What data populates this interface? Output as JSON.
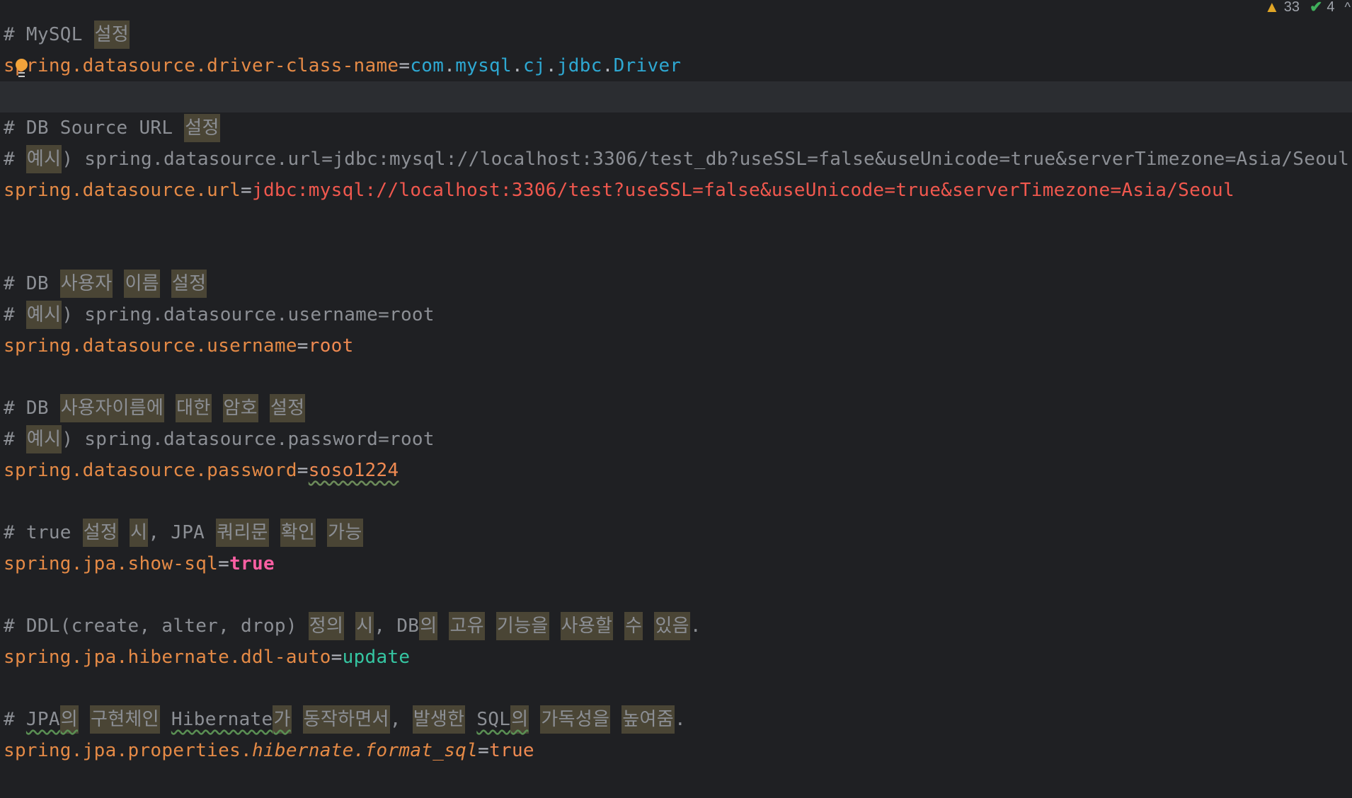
{
  "status": {
    "warnings": "33",
    "checks": "4",
    "warning_icon": "warning-triangle-icon",
    "check_icon": "double-check-icon",
    "chevron": "^"
  },
  "lines": {
    "l1": {
      "hash": "# ",
      "t1": "MySQL ",
      "k1": "설정"
    },
    "l2": {
      "key": "spring.datasource.driver-class-name",
      "eq": "=",
      "v1": "com",
      "d1": ".",
      "v2": "mysql",
      "d2": ".",
      "v3": "cj",
      "d3": ".",
      "v4": "jdbc",
      "d4": ".",
      "v5": "Driver"
    },
    "l4": {
      "hash": "# ",
      "t1": "DB Source URL ",
      "k1": "설정"
    },
    "l5": {
      "hash": "# ",
      "k1": "예시",
      "t1": ") spring.datasource.url=jdbc:mysql://localhost:3306/test_db?useSSL=false&useUnicode=true&serverTimezone=Asia/Seoul"
    },
    "l6": {
      "key": "spring.datasource.url",
      "eq": "=",
      "val": "jdbc:mysql://localhost:3306/test?useSSL=false&useUnicode=true&serverTimezone=Asia/Seoul"
    },
    "l9": {
      "hash": "# ",
      "t1": "DB ",
      "k1": "사용자",
      "k2": "이름",
      "k3": "설정"
    },
    "l10": {
      "hash": "# ",
      "k1": "예시",
      "t1": ") spring.datasource.username=root"
    },
    "l11": {
      "key": "spring.datasource.username",
      "eq": "=",
      "val": "root"
    },
    "l13": {
      "hash": "# ",
      "t1": "DB ",
      "k1": "사용자이름에",
      "k2": "대한",
      "k3": "암호",
      "k4": "설정"
    },
    "l14": {
      "hash": "# ",
      "k1": "예시",
      "t1": ") spring.datasource.password=root"
    },
    "l15": {
      "key": "spring.datasource.password",
      "eq": "=",
      "val": "soso1224"
    },
    "l17": {
      "hash": "# ",
      "t1": "true ",
      "k1": "설정",
      "k2": "시",
      "t2": ", JPA ",
      "k3": "쿼리문",
      "k4": "확인",
      "k5": "가능"
    },
    "l18": {
      "key": "spring.jpa.show-sql",
      "eq": "=",
      "val": "true"
    },
    "l20": {
      "hash": "# ",
      "t1": "DDL(create, alter, drop) ",
      "k1": "정의",
      "k2": "시",
      "t2": ", DB",
      "k3": "의",
      "k4": "고유",
      "k5": "기능을",
      "k6": "사용할",
      "k7": "수",
      "k8": "있음",
      "t3": "."
    },
    "l21": {
      "key": "spring.jpa.hibernate.ddl-auto",
      "eq": "=",
      "val": "update"
    },
    "l23": {
      "hash": "# ",
      "t1": "JPA",
      "k1": "의",
      "k2": "구현체인",
      "t2": "Hibernate",
      "k3": "가",
      "k4": "동작하면서",
      "t3": ", ",
      "k5": "발생한",
      "t4": "SQL",
      "k6": "의",
      "k7": "가독성을",
      "k8": "높여줌",
      "t5": "."
    },
    "l24": {
      "key1": "spring.jpa.properties.",
      "key2": "hibernate",
      "dot": ".",
      "key3": "format_sql",
      "eq": "=",
      "val": "true"
    }
  },
  "colors": {
    "background": "#1f2023",
    "current_line": "#2b2d31",
    "comment": "#8c8f95",
    "korean_highlight": "#4a4535",
    "key": "#e58a46",
    "class_ref": "#2ea8d2",
    "url_string": "#f1584e",
    "value": "#ef8a52",
    "boolean_true": "#fc5fa3",
    "update_value": "#35c6a2",
    "warning": "#e0a526",
    "check": "#3fae5b"
  }
}
